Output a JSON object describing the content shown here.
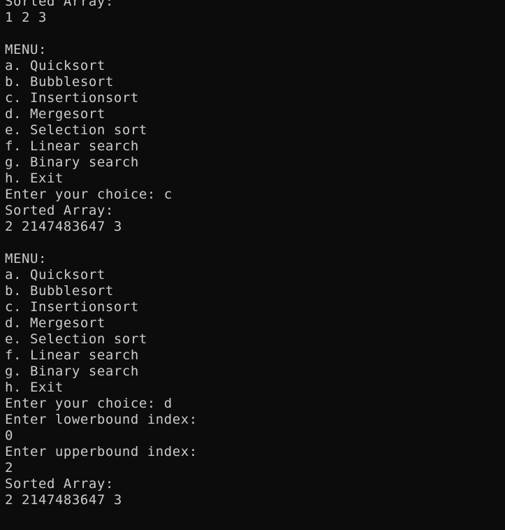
{
  "terminal": {
    "lines": [
      "Sorted Array:",
      "1 2 3",
      "",
      "MENU:",
      "a. Quicksort",
      "b. Bubblesort",
      "c. Insertionsort",
      "d. Mergesort",
      "e. Selection sort",
      "f. Linear search",
      "g. Binary search",
      "h. Exit",
      "Enter your choice: c",
      "Sorted Array:",
      "2 2147483647 3",
      "",
      "MENU:",
      "a. Quicksort",
      "b. Bubblesort",
      "c. Insertionsort",
      "d. Mergesort",
      "e. Selection sort",
      "f. Linear search",
      "g. Binary search",
      "h. Exit",
      "Enter your choice: d",
      "Enter lowerbound index:",
      "0",
      "Enter upperbound index:",
      "2",
      "Sorted Array:",
      "2 2147483647 3"
    ]
  },
  "colors": {
    "background": "#0c0c0c",
    "foreground": "#cccccc"
  }
}
